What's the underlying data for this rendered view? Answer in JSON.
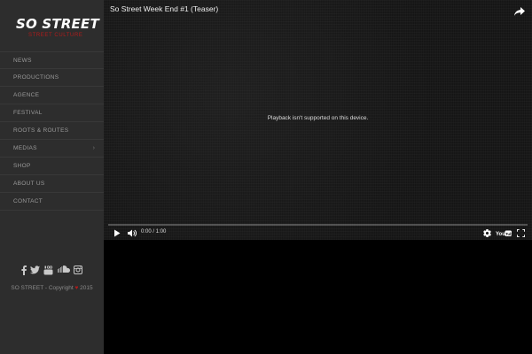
{
  "brand": {
    "logo_text": "SO STREET",
    "logo_subtext": "STREET CULTURE"
  },
  "nav": {
    "items": [
      {
        "label": "NEWS"
      },
      {
        "label": "PRODUCTIONS"
      },
      {
        "label": "AGENCE"
      },
      {
        "label": "FESTIVAL"
      },
      {
        "label": "ROOTS & ROUTES"
      },
      {
        "label": "MEDIAS",
        "has_submenu": true
      },
      {
        "label": "SHOP"
      },
      {
        "label": "ABOUT US"
      },
      {
        "label": "CONTACT"
      }
    ]
  },
  "social": [
    "facebook-icon",
    "twitter-icon",
    "youtube-icon",
    "soundcloud-icon",
    "instagram-icon"
  ],
  "footer": {
    "copyright_prefix": "SO STREET - Copyright",
    "heart": "♥",
    "year": "2015"
  },
  "video": {
    "title": "So Street Week End #1 (Teaser)",
    "message": "Playback isn't supported on this device.",
    "time": "0:00 / 1:00",
    "progress": 0.0
  },
  "colors": {
    "sidebar_bg": "#2d2d2d",
    "accent_red": "#b11b1b",
    "nav_text": "#9a9a9a"
  }
}
